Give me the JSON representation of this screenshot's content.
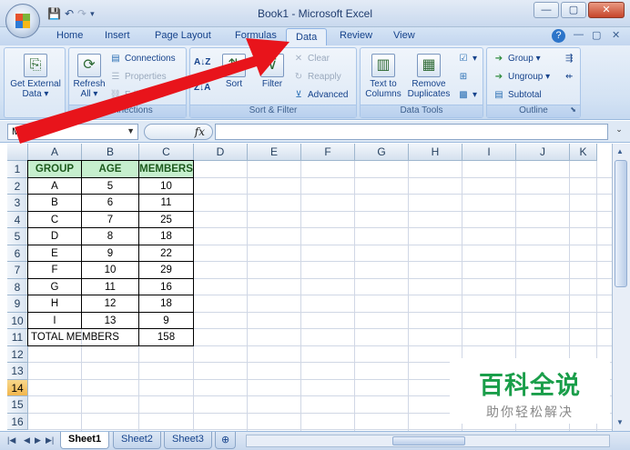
{
  "window": {
    "title": "Book1 - Microsoft Excel",
    "minimize": "—",
    "maximize": "▢",
    "close": "✕"
  },
  "tabs": [
    {
      "label": "Home"
    },
    {
      "label": "Insert"
    },
    {
      "label": "Page Layout"
    },
    {
      "label": "Formulas"
    },
    {
      "label": "Data"
    },
    {
      "label": "Review"
    },
    {
      "label": "View"
    }
  ],
  "ribbon": {
    "get_external_data": "Get External Data",
    "refresh_all": "Refresh All",
    "connections": "Connections",
    "properties": "Properties",
    "edit_links": "Edit Links",
    "group_connections": "Connections",
    "sort_az": "A↓Z",
    "sort_za": "Z↓A",
    "sort": "Sort",
    "filter": "Filter",
    "clear": "Clear",
    "reapply": "Reapply",
    "advanced": "Advanced",
    "group_sort_filter": "Sort & Filter",
    "text_to_columns": "Text to Columns",
    "remove_duplicates": "Remove Duplicates",
    "group_data_tools": "Data Tools",
    "group": "Group",
    "ungroup": "Ungroup",
    "subtotal": "Subtotal",
    "group_outline": "Outline"
  },
  "formula_bar": {
    "name_box": "M14",
    "fx": "fx",
    "value": ""
  },
  "columns": [
    "A",
    "B",
    "C",
    "D",
    "E",
    "F",
    "G",
    "H",
    "I",
    "J",
    "K"
  ],
  "rows": [
    "1",
    "2",
    "3",
    "4",
    "5",
    "6",
    "7",
    "8",
    "9",
    "10",
    "11",
    "12",
    "13",
    "14",
    "15",
    "16"
  ],
  "selected_row": "14",
  "table": {
    "headers": [
      "GROUP",
      "AGE",
      "MEMBERS"
    ],
    "rows": [
      [
        "A",
        "5",
        "10"
      ],
      [
        "B",
        "6",
        "11"
      ],
      [
        "C",
        "7",
        "25"
      ],
      [
        "D",
        "8",
        "18"
      ],
      [
        "E",
        "9",
        "22"
      ],
      [
        "F",
        "10",
        "29"
      ],
      [
        "G",
        "11",
        "16"
      ],
      [
        "H",
        "12",
        "18"
      ],
      [
        "I",
        "13",
        "9"
      ]
    ],
    "total_label": "TOTAL MEMBERS",
    "total_value": "158"
  },
  "sheets": [
    {
      "label": "Sheet1",
      "active": true
    },
    {
      "label": "Sheet2",
      "active": false
    },
    {
      "label": "Sheet3",
      "active": false
    }
  ],
  "watermark": {
    "line1": "百科全说",
    "line2": "助你轻松解决"
  },
  "colors": {
    "header_fill": "#c6efce",
    "arrow": "#e8141b",
    "selected_row": "#f2b64c"
  }
}
